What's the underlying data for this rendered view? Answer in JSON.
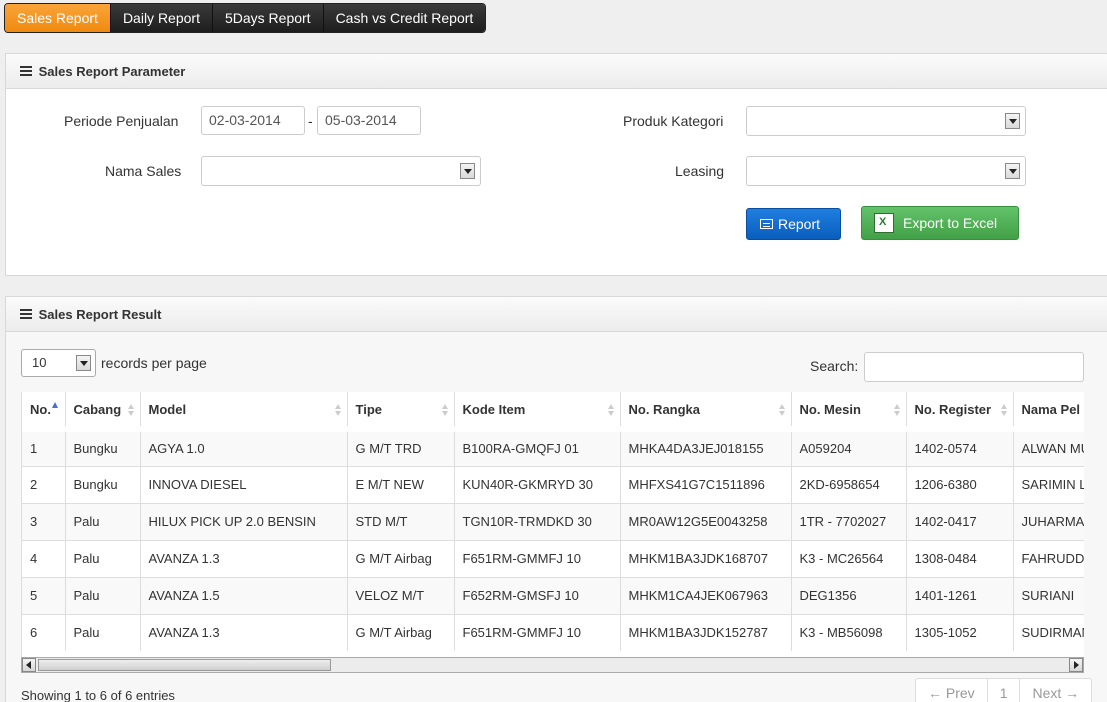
{
  "tabs": [
    {
      "label": "Sales Report"
    },
    {
      "label": "Daily Report"
    },
    {
      "label": "5Days Report"
    },
    {
      "label": "Cash vs Credit Report"
    }
  ],
  "params": {
    "title": "Sales Report Parameter",
    "periode_label": "Periode Penjualan",
    "date_from": "02-03-2014",
    "date_sep": "-",
    "date_to": "05-03-2014",
    "nama_sales_label": "Nama Sales",
    "nama_sales_value": "",
    "produk_kategori_label": "Produk Kategori",
    "produk_kategori_value": "",
    "leasing_label": "Leasing",
    "leasing_value": "",
    "report_button": "Report",
    "export_button": "Export to Excel"
  },
  "results": {
    "title": "Sales Report Result",
    "page_length": "10",
    "records_per_page": "records per page",
    "search_label": "Search:",
    "search_value": "",
    "columns": [
      "No.",
      "Cabang",
      "Model",
      "Tipe",
      "Kode Item",
      "No. Rangka",
      "No. Mesin",
      "No. Register",
      "Nama Pel"
    ],
    "rows": [
      [
        "1",
        "Bungku",
        "AGYA 1.0",
        "G M/T TRD",
        "B100RA-GMQFJ 01",
        "MHKA4DA3JEJ018155",
        "A059204",
        "1402-0574",
        "ALWAN MU"
      ],
      [
        "2",
        "Bungku",
        "INNOVA DIESEL",
        "E M/T NEW",
        "KUN40R-GKMRYD 30",
        "MHFXS41G7C1511896",
        "2KD-6958654",
        "1206-6380",
        "SARIMIN L"
      ],
      [
        "3",
        "Palu",
        "HILUX PICK UP 2.0 BENSIN",
        "STD M/T",
        "TGN10R-TRMDKD 30",
        "MR0AW12G5E0043258",
        "1TR - 7702027",
        "1402-0417",
        "JUHARMA"
      ],
      [
        "4",
        "Palu",
        "AVANZA 1.3",
        "G M/T Airbag",
        "F651RM-GMMFJ 10",
        "MHKM1BA3JDK168707",
        "K3 - MC26564",
        "1308-0484",
        "FAHRUDDI"
      ],
      [
        "5",
        "Palu",
        "AVANZA 1.5",
        "VELOZ M/T",
        "F652RM-GMSFJ 10",
        "MHKM1CA4JEK067963",
        "DEG1356",
        "1401-1261",
        "SURIANI"
      ],
      [
        "6",
        "Palu",
        "AVANZA 1.3",
        "G M/T Airbag",
        "F651RM-GMMFJ 10",
        "MHKM1BA3JDK152787",
        "K3 - MB56098",
        "1305-1052",
        "SUDIRMAN"
      ]
    ],
    "info": "Showing 1 to 6 of 6 entries",
    "pager": {
      "prev": "← Prev",
      "page": "1",
      "next": "Next →"
    }
  }
}
